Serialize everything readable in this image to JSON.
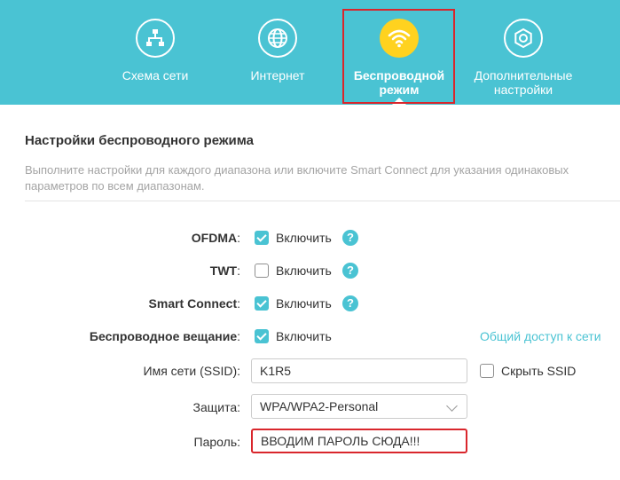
{
  "nav": {
    "items": [
      {
        "label": "Схема сети",
        "icon": "network-map-icon"
      },
      {
        "label": "Интернет",
        "icon": "globe-icon"
      },
      {
        "label": "Беспроводной режим",
        "icon": "wifi-icon"
      },
      {
        "label": "Дополнительные настройки",
        "icon": "gear-icon"
      }
    ],
    "colors": {
      "bar": "#4ac3d3",
      "active_icon": "#ffd21f",
      "highlight": "#d9262c"
    }
  },
  "section": {
    "title": "Настройки беспроводного режима",
    "description": "Выполните настройки для каждого диапазона или включите Smart Connect для указания одинаковых параметров по всем диапазонам."
  },
  "form": {
    "ofdma": {
      "label": "OFDMA",
      "colon": ":",
      "option": "Включить",
      "checked": true
    },
    "twt": {
      "label": "TWT",
      "colon": ":",
      "option": "Включить",
      "checked": false
    },
    "smart_connect": {
      "label": "Smart Connect",
      "colon": ":",
      "option": "Включить",
      "checked": true
    },
    "broadcast": {
      "label": "Беспроводное вещание",
      "colon": ":",
      "option": "Включить",
      "checked": true
    },
    "share_link": "Общий доступ к сети",
    "ssid": {
      "label": "Имя сети (SSID):",
      "value": "K1R5",
      "hide_label": "Скрыть SSID",
      "hide_checked": false
    },
    "security": {
      "label": "Защита:",
      "value": "WPA/WPA2-Personal"
    },
    "password": {
      "label": "Пароль:",
      "value": "ВВОДИМ ПАРОЛЬ СЮДА!!!"
    },
    "help_glyph": "?"
  }
}
